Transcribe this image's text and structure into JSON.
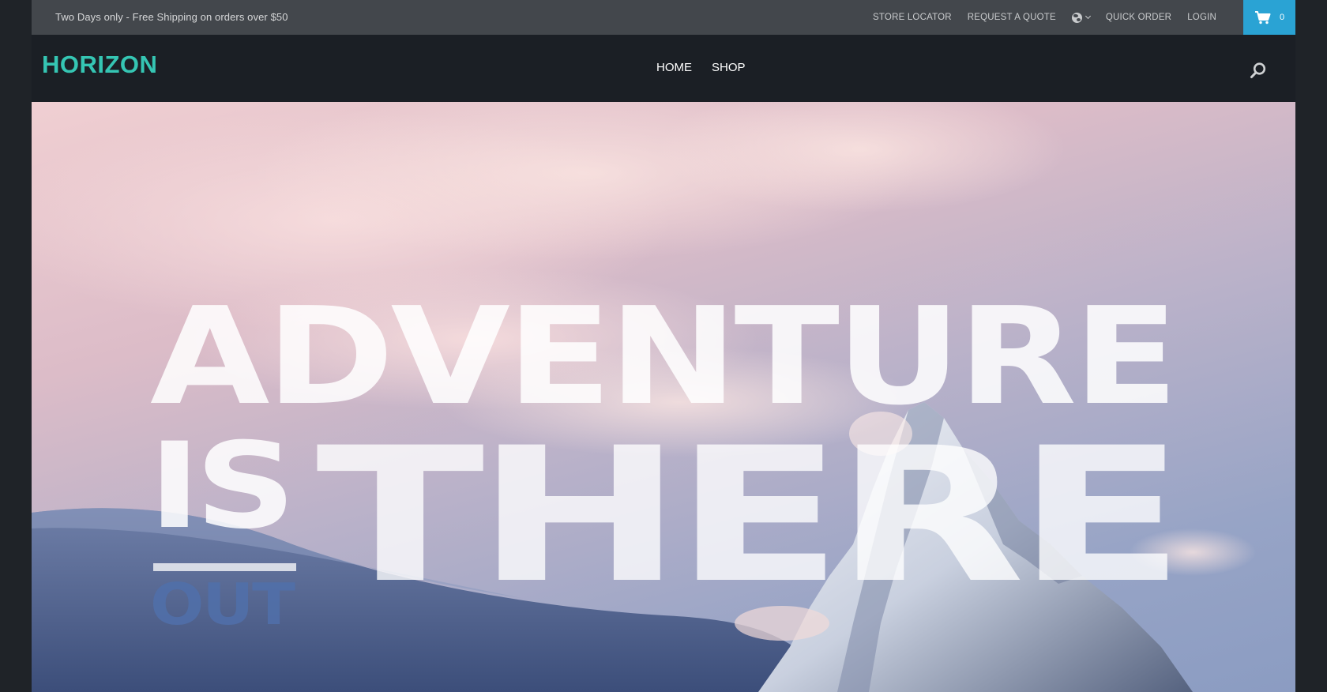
{
  "topbar": {
    "promo_text": "Two Days only - Free Shipping on orders over $50",
    "links": {
      "store_locator": "STORE LOCATOR",
      "request_quote": "REQUEST A QUOTE",
      "quick_order": "QUICK ORDER",
      "login": "LOGIN"
    },
    "language_icon": "globe-icon",
    "cart": {
      "count": "0",
      "icon": "cart-icon"
    }
  },
  "header": {
    "logo": "HORIZON",
    "nav": {
      "home": "HOME",
      "shop": "SHOP"
    },
    "search_icon": "search-icon"
  },
  "hero": {
    "line1": "ADVENTURE",
    "is": "IS",
    "out": "OUT",
    "there": "THERE"
  },
  "colors": {
    "topbar_bg": "#43474c",
    "header_bg": "#1b1f25",
    "logo": "#35c5b3",
    "cart_bg": "#2aa3d4"
  }
}
